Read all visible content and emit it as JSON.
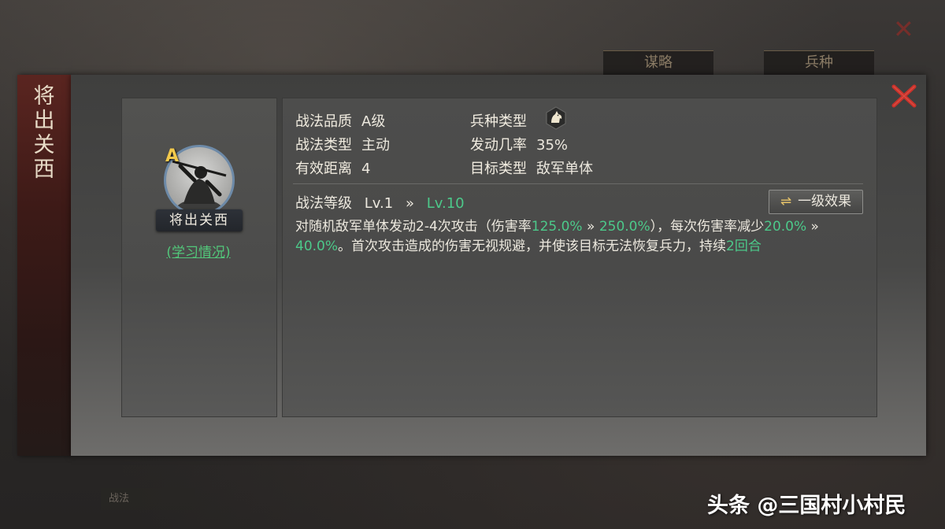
{
  "background": {
    "tabs": [
      "谋略",
      "兵种"
    ],
    "bottom_button": "战法"
  },
  "skill": {
    "name_vertical": "将出关西",
    "name": "将出关西",
    "grade": "A",
    "study_link": "(学习情况)"
  },
  "attributes": {
    "quality_label": "战法品质",
    "quality_value": "A级",
    "type_label": "战法类型",
    "type_value": "主动",
    "range_label": "有效距离",
    "range_value": "4",
    "troop_label": "兵种类型",
    "troop_icon": "horse-cavalry-icon",
    "rate_label": "发动几率",
    "rate_value": "35%",
    "target_label": "目标类型",
    "target_value": "敌军单体"
  },
  "level": {
    "label": "战法等级",
    "from": "Lv.1",
    "arrow": "»",
    "to": "Lv.10"
  },
  "effect_button": {
    "icon": "⇌",
    "label": "一级效果"
  },
  "description": {
    "p1": "对随机敌军单体发动2-4次攻击（伤害率",
    "v1": "125.0%",
    "arrow1": " » ",
    "v2": "250.0%",
    "p2": "），每次伤害率减少",
    "v3": "20.0%",
    "arrow2": " » ",
    "v4": "40.0%",
    "p3": "。首次攻击造成的伤害无视规避，并使该目标无法恢复兵力，持续",
    "v5": "2回合"
  },
  "watermark": "头条 @三国村小村民",
  "colors": {
    "highlight_green": "#4cc98a",
    "grade_gold": "#f2c94c",
    "close_red": "#c8322b"
  }
}
